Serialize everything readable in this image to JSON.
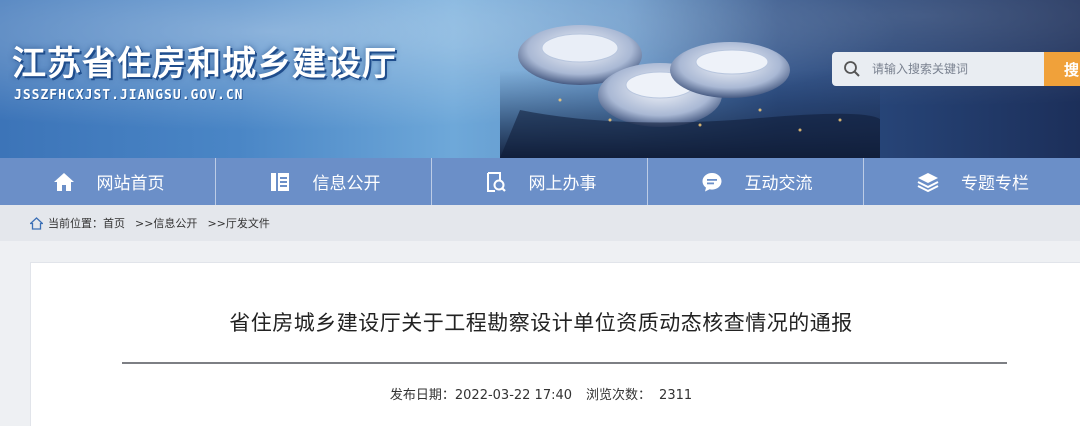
{
  "header": {
    "site_title": "江苏省住房和城乡建设厅",
    "site_domain": "JSSZFHCXJST.JIANGSU.GOV.CN",
    "search_placeholder": "请输入搜索关键词",
    "search_button": "搜"
  },
  "nav": {
    "items": [
      {
        "label": "网站首页",
        "icon": "home-icon"
      },
      {
        "label": "信息公开",
        "icon": "document-icon"
      },
      {
        "label": "网上办事",
        "icon": "search-document-icon"
      },
      {
        "label": "互动交流",
        "icon": "chat-icon"
      },
      {
        "label": "专题专栏",
        "icon": "layers-icon"
      }
    ]
  },
  "breadcrumb": {
    "prefix": "当前位置：",
    "items": [
      "首页",
      ">>信息公开",
      ">>厅发文件"
    ]
  },
  "article": {
    "title": "省住房城乡建设厅关于工程勘察设计单位资质动态核查情况的通报",
    "date_label": "发布日期：",
    "date_value": "2022-03-22 17:40",
    "views_label": "浏览次数：",
    "views_value": "2311"
  },
  "colors": {
    "nav_bg": "#6b8fc8",
    "search_button_bg": "#f0a13a",
    "breadcrumb_bg": "#e4e7ec",
    "page_bg": "#eef0f3"
  }
}
